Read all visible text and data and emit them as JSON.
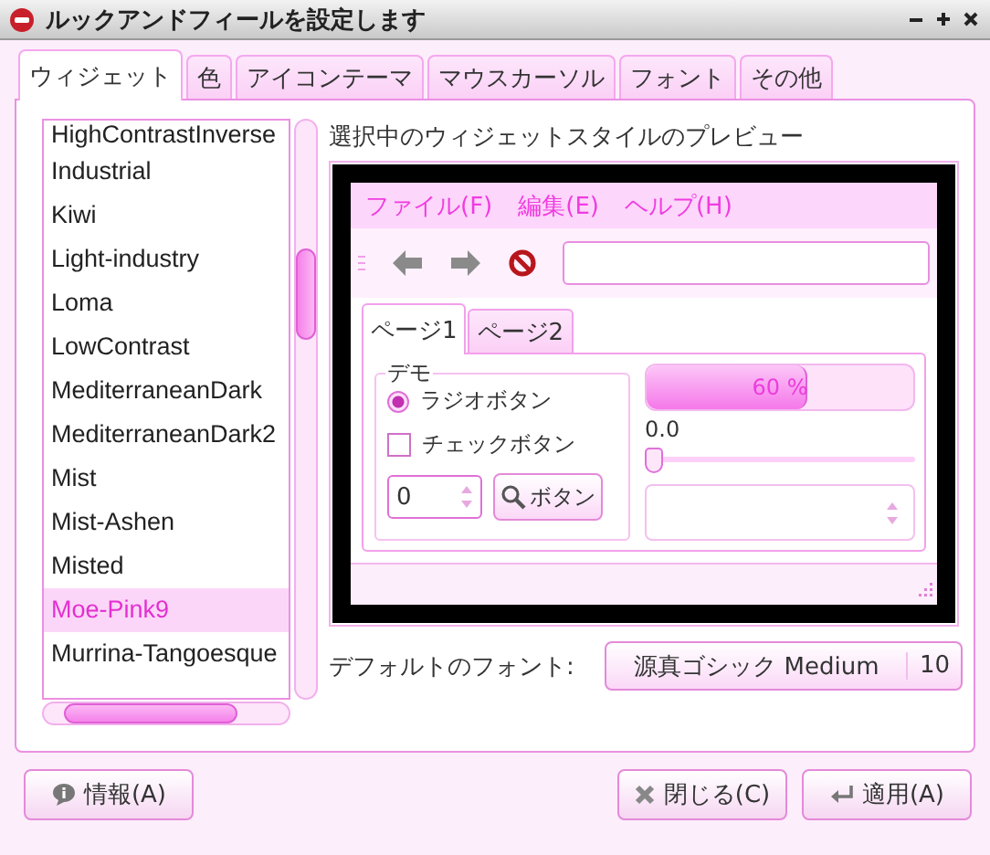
{
  "window": {
    "title": "ルックアンドフィールを設定します"
  },
  "tabs": [
    {
      "label": "ウィジェット",
      "selected": true
    },
    {
      "label": "色",
      "selected": false
    },
    {
      "label": "アイコンテーマ",
      "selected": false
    },
    {
      "label": "マウスカーソル",
      "selected": false
    },
    {
      "label": "フォント",
      "selected": false
    },
    {
      "label": "その他",
      "selected": false
    }
  ],
  "themes": [
    {
      "name": "HighContrastInverse",
      "selected": false
    },
    {
      "name": "Industrial",
      "selected": false
    },
    {
      "name": "Kiwi",
      "selected": false
    },
    {
      "name": "Light-industry",
      "selected": false
    },
    {
      "name": "Loma",
      "selected": false
    },
    {
      "name": "LowContrast",
      "selected": false
    },
    {
      "name": "MediterraneanDark",
      "selected": false
    },
    {
      "name": "MediterraneanDark2",
      "selected": false
    },
    {
      "name": "Mist",
      "selected": false
    },
    {
      "name": "Mist-Ashen",
      "selected": false
    },
    {
      "name": "Misted",
      "selected": false
    },
    {
      "name": "Moe-Pink9",
      "selected": true
    },
    {
      "name": "Murrina-Tangoesque",
      "selected": false
    }
  ],
  "preview": {
    "label": "選択中のウィジェットスタイルのプレビュー",
    "menu": [
      "ファイル(F)",
      "編集(E)",
      "ヘルプ(H)"
    ],
    "tabs": [
      {
        "label": "ページ1",
        "selected": true
      },
      {
        "label": "ページ2",
        "selected": false
      }
    ],
    "frame_label": "デモ",
    "radio": {
      "label": "ラジオボタン",
      "checked": true
    },
    "checkbox": {
      "label": "チェックボタン",
      "checked": false
    },
    "spin_value": "0",
    "button": "ボタン",
    "progress": {
      "level": 0.6,
      "text": "60 %"
    },
    "scale": {
      "reading": "0.0",
      "level": 0
    }
  },
  "font": {
    "label": "デフォルトのフォント:",
    "name": "源真ゴシック Medium",
    "size": "10"
  },
  "buttons": [
    {
      "kind": "info",
      "label": "情報(A)"
    },
    {
      "kind": "close",
      "label": "閉じる(C)"
    },
    {
      "kind": "apply",
      "label": "適用(A)"
    }
  ]
}
